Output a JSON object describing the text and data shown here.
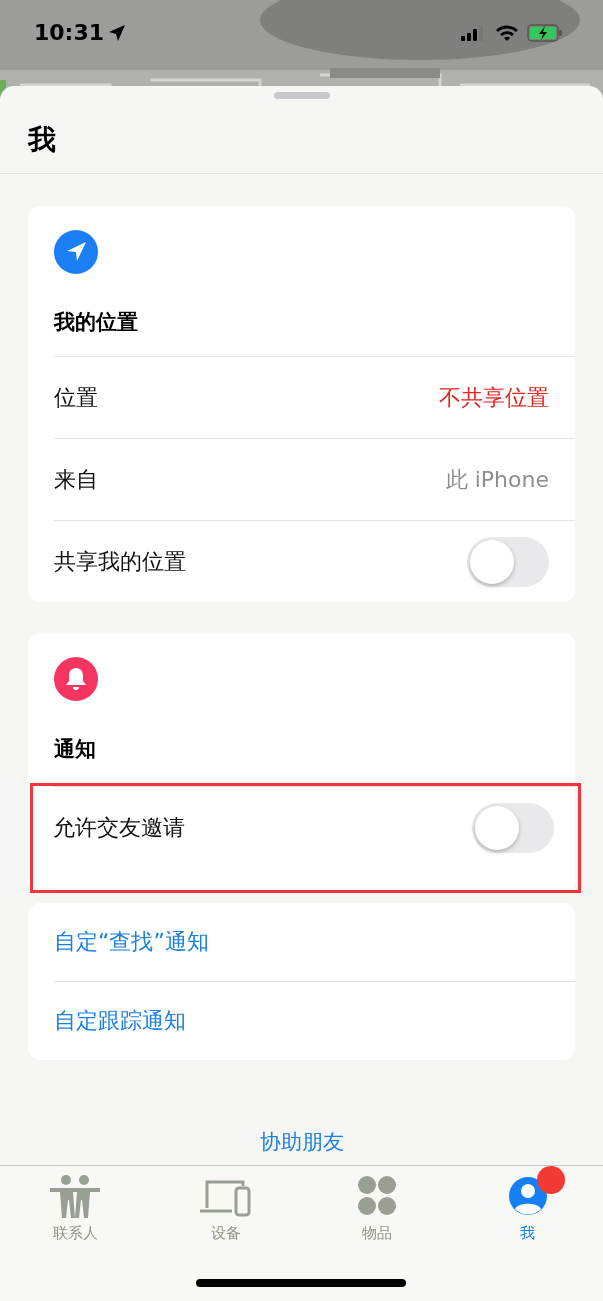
{
  "status_bar": {
    "time": "10:31"
  },
  "sheet": {
    "title": "我"
  },
  "sections": [
    {
      "kind": "location",
      "title": "我的位置",
      "rows": [
        {
          "kind": "value",
          "label": "位置",
          "value": "不共享位置",
          "alert": true
        },
        {
          "kind": "value",
          "label": "来自",
          "value": "此 iPhone",
          "alert": false
        },
        {
          "kind": "toggle",
          "label": "共享我的位置",
          "on": false,
          "highlighted": false
        }
      ]
    },
    {
      "kind": "notifications",
      "title": "通知",
      "rows": [
        {
          "kind": "toggle",
          "label": "允许交友邀请",
          "on": false,
          "highlighted": true
        }
      ]
    }
  ],
  "links": [
    "自定“查找”通知",
    "自定跟踪通知"
  ],
  "help_link": "协助朋友",
  "tabs": [
    {
      "kind": "people",
      "label": "联系人",
      "selected": false,
      "badge": false
    },
    {
      "kind": "devices",
      "label": "设备",
      "selected": false,
      "badge": false
    },
    {
      "kind": "items",
      "label": "物品",
      "selected": false,
      "badge": false
    },
    {
      "kind": "me",
      "label": "我",
      "selected": true,
      "badge": true
    }
  ]
}
